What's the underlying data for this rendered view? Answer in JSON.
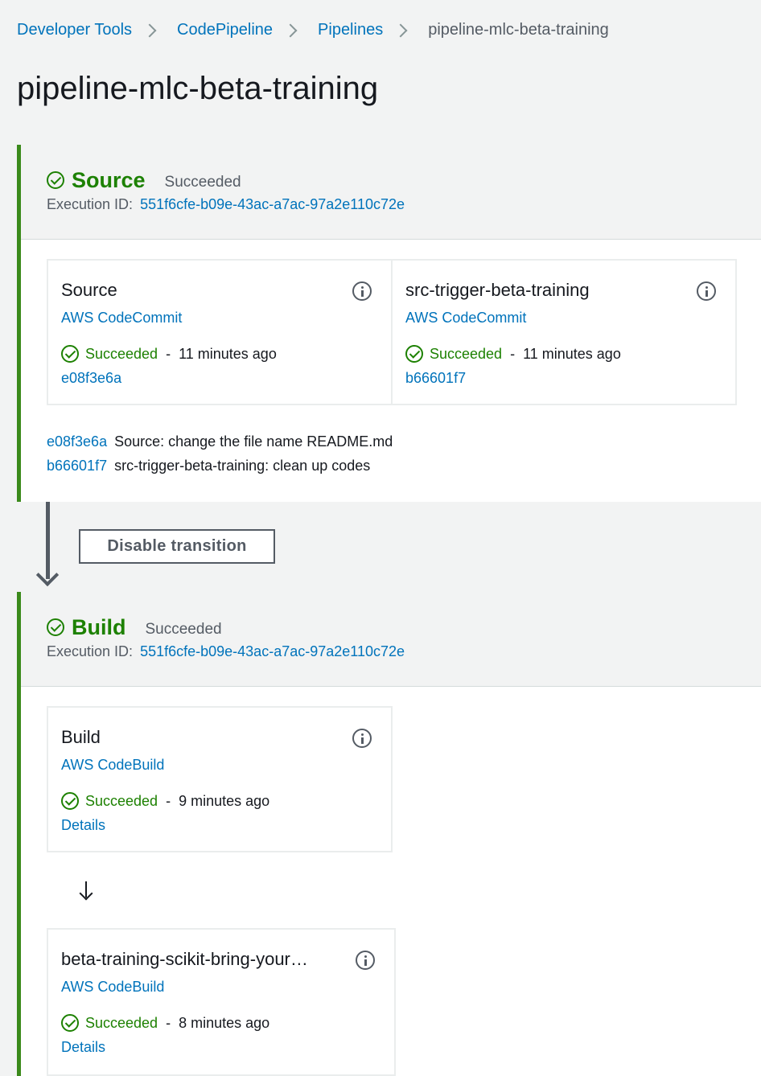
{
  "breadcrumb": {
    "items": [
      "Developer Tools",
      "CodePipeline",
      "Pipelines"
    ],
    "current": "pipeline-mlc-beta-training"
  },
  "page": {
    "title": "pipeline-mlc-beta-training"
  },
  "stages": [
    {
      "name": "Source",
      "status": "Succeeded",
      "execution_label": "Execution ID:",
      "execution_id": "551f6cfe-b09e-43ac-a7ac-97a2e110c72e",
      "actions": [
        {
          "title": "Source",
          "provider": "AWS CodeCommit",
          "status": "Succeeded",
          "separator": "-",
          "time": "11 minutes ago",
          "link": "e08f3e6a"
        },
        {
          "title": "src-trigger-beta-training",
          "provider": "AWS CodeCommit",
          "status": "Succeeded",
          "separator": "-",
          "time": "11 minutes ago",
          "link": "b66601f7"
        }
      ],
      "commits": [
        {
          "id": "e08f3e6a",
          "message": "Source: change the file name README.md"
        },
        {
          "id": "b66601f7",
          "message": "src-trigger-beta-training: clean up codes"
        }
      ]
    },
    {
      "name": "Build",
      "status": "Succeeded",
      "execution_label": "Execution ID:",
      "execution_id": "551f6cfe-b09e-43ac-a7ac-97a2e110c72e",
      "actions": [
        {
          "title": "Build",
          "provider": "AWS CodeBuild",
          "status": "Succeeded",
          "separator": "-",
          "time": "9 minutes ago",
          "link": "Details"
        },
        {
          "title": "beta-training-scikit-bring-your…",
          "provider": "AWS CodeBuild",
          "status": "Succeeded",
          "separator": "-",
          "time": "8 minutes ago",
          "link": "Details"
        }
      ]
    }
  ],
  "transition": {
    "button_label": "Disable transition"
  },
  "colors": {
    "success": "#1d8102",
    "link": "#0073bb",
    "stage_border": "#3b8a1b"
  }
}
